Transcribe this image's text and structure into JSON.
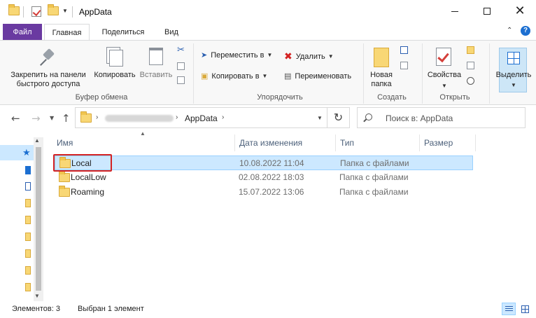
{
  "window": {
    "title": "AppData"
  },
  "ribbon_tabs": [
    "Файл",
    "Главная",
    "Поделиться",
    "Вид"
  ],
  "ribbon": {
    "clipboard": {
      "pin_label": "Закрепить на панели быстрого доступа",
      "copy_label": "Копировать",
      "paste_label": "Вставить",
      "group_label": "Буфер обмена"
    },
    "organize": {
      "move_label": "Переместить в",
      "copy_to_label": "Копировать в",
      "delete_label": "Удалить",
      "rename_label": "Переименовать",
      "group_label": "Упорядочить"
    },
    "new": {
      "new_folder_label": "Новая папка",
      "group_label": "Создать"
    },
    "open": {
      "properties_label": "Свойства",
      "group_label": "Открыть"
    },
    "select": {
      "select_label": "Выделить"
    }
  },
  "address": {
    "current_folder": "AppData"
  },
  "search": {
    "placeholder": "Поиск в: AppData"
  },
  "columns": [
    "Имя",
    "Дата изменения",
    "Тип",
    "Размер"
  ],
  "files": [
    {
      "name": "Local",
      "date": "10.08.2022 11:04",
      "type": "Папка с файлами",
      "size": ""
    },
    {
      "name": "LocalLow",
      "date": "02.08.2022 18:03",
      "type": "Папка с файлами",
      "size": ""
    },
    {
      "name": "Roaming",
      "date": "15.07.2022 13:06",
      "type": "Папка с файлами",
      "size": ""
    }
  ],
  "status": {
    "items_count": "Элементов: 3",
    "selected": "Выбран 1 элемент"
  },
  "colors": {
    "file_tab": "#6a3aa1",
    "selection": "#cce8ff",
    "highlight_box": "#d42222",
    "folder": "#f8d775"
  }
}
